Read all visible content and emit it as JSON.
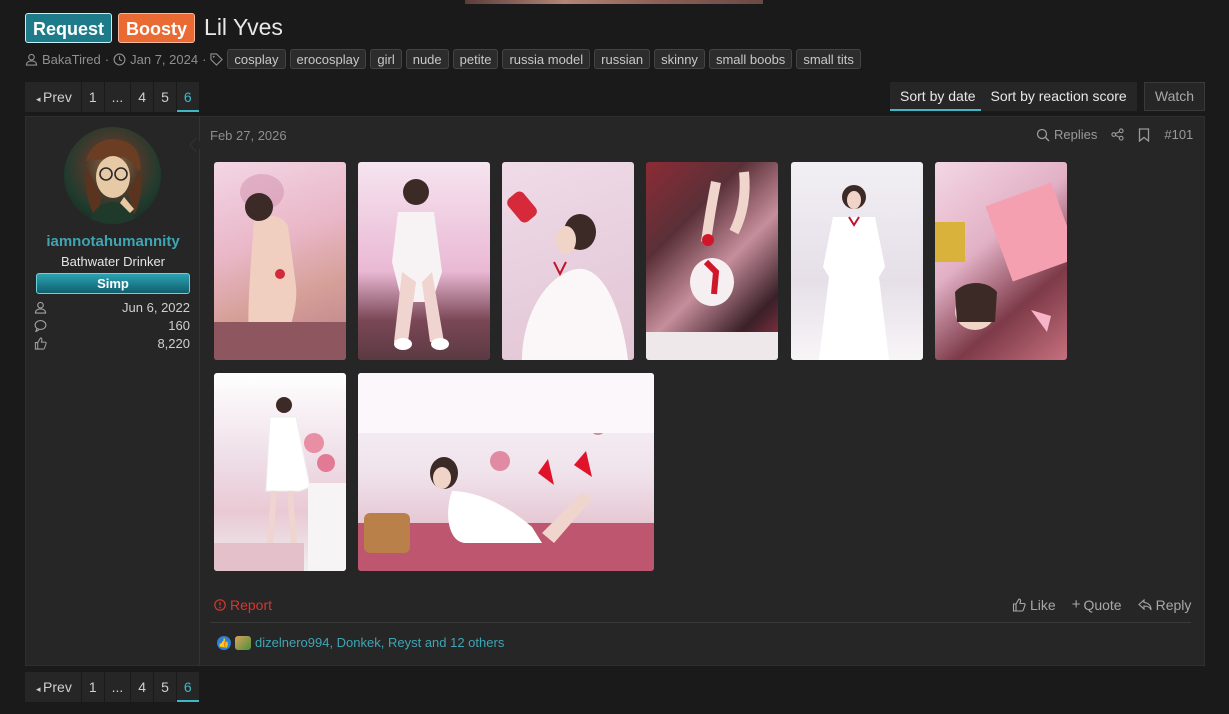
{
  "thread": {
    "labels": [
      "Request",
      "Boosty"
    ],
    "title": "Lil Yves",
    "author": "BakaTired",
    "date": "Jan 7, 2024",
    "tags": [
      "cosplay",
      "erocosplay",
      "girl",
      "nude",
      "petite",
      "russia model",
      "russian",
      "skinny",
      "small boobs",
      "small tits"
    ]
  },
  "pagination": {
    "prev_label": "Prev",
    "pages": [
      "1",
      "...",
      "4",
      "5",
      "6"
    ],
    "current": "6"
  },
  "sort": {
    "by_date": "Sort by date",
    "by_reaction": "Sort by reaction score",
    "watch": "Watch"
  },
  "post": {
    "user": {
      "name": "iamnotahumannity",
      "title": "Bathwater Drinker",
      "banner": "Simp",
      "joined": "Jun 6, 2022",
      "messages": "160",
      "reactions": "8,220"
    },
    "date": "Feb 27, 2026",
    "actions": {
      "replies": "Replies",
      "number": "#101"
    },
    "footer": {
      "report": "Report",
      "like": "Like",
      "quote": "Quote",
      "reply": "Reply"
    },
    "reactions_text": "dizelnero994, Donkek, Reyst and 12 others",
    "image_count": 8
  },
  "colors": {
    "accent": "#3fb8c6",
    "report": "#d4382f",
    "request_label": "#1e7b8a",
    "boosty_label": "#ea6a34"
  },
  "icons": [
    "user-icon",
    "clock-icon",
    "tag-icon",
    "search-icon",
    "share-icon",
    "bookmark-icon",
    "thumbs-up-icon",
    "plus-icon",
    "reply-icon",
    "warning-icon",
    "message-icon"
  ]
}
